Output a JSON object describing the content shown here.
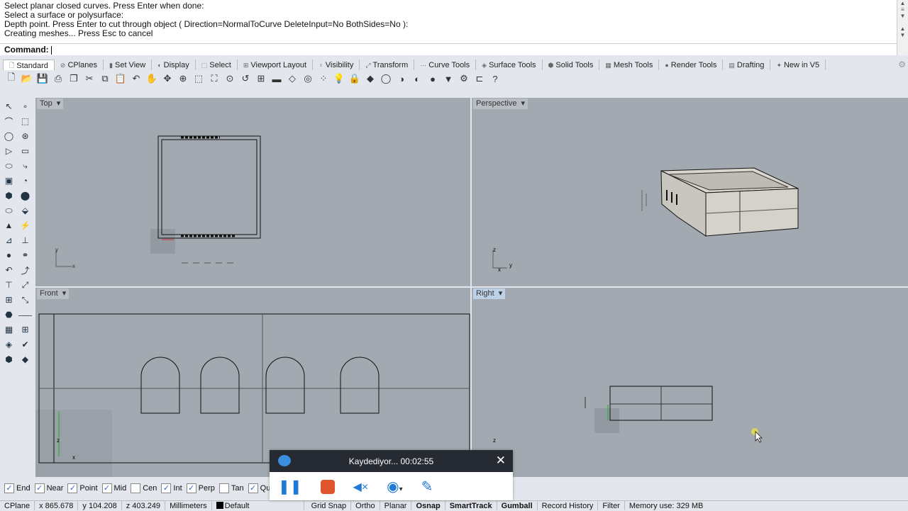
{
  "history": [
    "Select planar closed curves. Press Enter when done:",
    "Select a surface or polysurface:",
    "Depth point. Press Enter to cut through object ( Direction=NormalToCurve  DeleteInput=No  BothSides=No ):",
    "Creating meshes... Press Esc to cancel"
  ],
  "command": {
    "label": "Command:",
    "value": ""
  },
  "tabs": [
    {
      "label": "Standard",
      "icon": "page-icon"
    },
    {
      "label": "CPlanes",
      "icon": "cplane-icon"
    },
    {
      "label": "Set View",
      "icon": "setview-icon"
    },
    {
      "label": "Display",
      "icon": "display-icon"
    },
    {
      "label": "Select",
      "icon": "select-icon"
    },
    {
      "label": "Viewport Layout",
      "icon": "grid-icon"
    },
    {
      "label": "Visibility",
      "icon": "bulb-icon"
    },
    {
      "label": "Transform",
      "icon": "transform-icon"
    },
    {
      "label": "Curve Tools",
      "icon": "curve-icon"
    },
    {
      "label": "Surface Tools",
      "icon": "surface-icon"
    },
    {
      "label": "Solid Tools",
      "icon": "solid-icon"
    },
    {
      "label": "Mesh Tools",
      "icon": "mesh-icon"
    },
    {
      "label": "Render Tools",
      "icon": "render-icon"
    },
    {
      "label": "Drafting",
      "icon": "drafting-icon"
    },
    {
      "label": "New in V5",
      "icon": "new-icon"
    }
  ],
  "viewports": {
    "top": "Top",
    "perspective": "Perspective",
    "front": "Front",
    "right": "Right"
  },
  "osnaps": [
    {
      "label": "End",
      "checked": true
    },
    {
      "label": "Near",
      "checked": true
    },
    {
      "label": "Point",
      "checked": true
    },
    {
      "label": "Mid",
      "checked": true
    },
    {
      "label": "Cen",
      "checked": false
    },
    {
      "label": "Int",
      "checked": true
    },
    {
      "label": "Perp",
      "checked": true
    },
    {
      "label": "Tan",
      "checked": false
    },
    {
      "label": "Quad",
      "checked": true
    }
  ],
  "status": {
    "cplane": "CPlane",
    "x": "x 865.678",
    "y": "y 104.208",
    "z": "z 403.249",
    "units": "Millimeters",
    "layer": "Default",
    "grid_snap": "Grid Snap",
    "ortho": "Ortho",
    "planar": "Planar",
    "osnap": "Osnap",
    "smarttrack": "SmartTrack",
    "gumball": "Gumball",
    "record_history": "Record History",
    "filter": "Filter",
    "memory": "Memory use: 329 MB"
  },
  "recorder": {
    "title": "Kaydediyor... 00:02:55"
  }
}
